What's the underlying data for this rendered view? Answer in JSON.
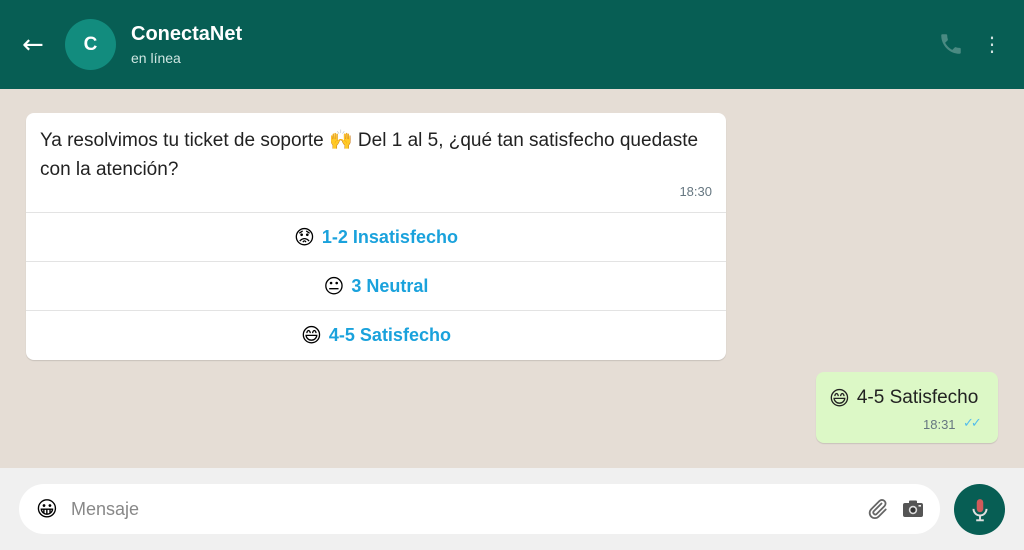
{
  "header": {
    "contact_name": "ConectaNet",
    "status": "en línea",
    "avatar_initial": "C",
    "back_icon": "←",
    "menu_icon": "⋮"
  },
  "messages": {
    "incoming": {
      "text": "Ya resolvimos tu ticket de soporte 🙌 Del 1 al 5, ¿qué tan satisfecho quedaste con la atención?",
      "time": "18:30",
      "options": [
        {
          "emoji": "😟",
          "label": "1-2 Insatisfecho"
        },
        {
          "emoji": "😐",
          "label": "3 Neutral"
        },
        {
          "emoji": "😄",
          "label": "4-5 Satisfecho"
        }
      ]
    },
    "outgoing": {
      "emoji": "😄",
      "text": "4-5 Satisfecho",
      "time": "18:31",
      "ticks": "✓✓"
    }
  },
  "composer": {
    "placeholder": "Mensaje",
    "emoji_icon": "😀"
  },
  "colors": {
    "header": "#075e54",
    "background": "#e5ddd5",
    "option_text": "#1aa2dc",
    "outgoing_bubble": "#dcf8c6",
    "read_ticks": "#53bdeb"
  },
  "icons": [
    "back-arrow-icon",
    "phone-icon",
    "more-options-icon",
    "emoji-icon",
    "paperclip-icon",
    "camera-icon",
    "microphone-icon"
  ]
}
